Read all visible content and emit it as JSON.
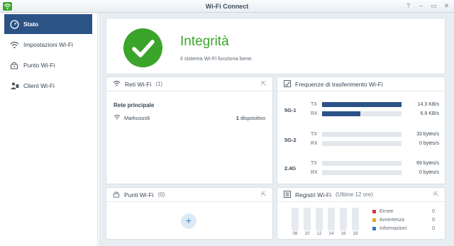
{
  "window": {
    "title": "Wi-Fi Connect",
    "controls": [
      "?",
      "–",
      "▭",
      "✕"
    ]
  },
  "sidebar": {
    "items": [
      {
        "label": "Stato",
        "icon": "gauge-icon",
        "active": true
      },
      {
        "label": "Impostazioni Wi-Fi",
        "icon": "wifi-icon",
        "active": false
      },
      {
        "label": "Punto Wi-Fi",
        "icon": "router-icon",
        "active": false
      },
      {
        "label": "Client Wi-Fi",
        "icon": "clients-icon",
        "active": false
      }
    ]
  },
  "status": {
    "title": "Integrità",
    "message": "Il sistema Wi-Fi funziona bene.",
    "color": "#3ba42a"
  },
  "networks": {
    "title": "Reti Wi-Fi",
    "count": "(1)",
    "heading": "Rete principale",
    "row": {
      "name": "Markusss6",
      "count": "1",
      "count_suffix": " dispositivo"
    }
  },
  "transfer": {
    "title": "Frequenze di trasferimento Wi-Fi",
    "bands": [
      {
        "name": "5G-1",
        "tx_label": "TX",
        "tx_value": "14.3 KB/s",
        "tx_fraction": 1.0,
        "rx_label": "RX",
        "rx_value": "6.9 KB/s",
        "rx_fraction": 0.48
      },
      {
        "name": "5G-2",
        "tx_label": "TX",
        "tx_value": "33 bytes/s",
        "tx_fraction": 0.0,
        "rx_label": "RX",
        "rx_value": "0 bytes/s",
        "rx_fraction": 0.0
      },
      {
        "name": "2.4G",
        "tx_label": "TX",
        "tx_value": "69 bytes/s",
        "tx_fraction": 0.0,
        "rx_label": "RX",
        "rx_value": "0 bytes/s",
        "rx_fraction": 0.0
      }
    ],
    "bar_color": "#2b5386"
  },
  "access_points": {
    "title": "Punti Wi-Fi",
    "count": "(0)",
    "add_label": "+"
  },
  "logs": {
    "title": "Registri Wi-Fi",
    "subtitle": "(Ultime 12 ore)",
    "x_labels": [
      "08",
      "10",
      "12",
      "14",
      "16",
      "18"
    ],
    "legend": [
      {
        "label": "Errore",
        "value": "0",
        "color": "#d6373a"
      },
      {
        "label": "Avvertenza",
        "value": "0",
        "color": "#f0a020"
      },
      {
        "label": "Informazioni",
        "value": "0",
        "color": "#2f7bc4"
      }
    ]
  }
}
